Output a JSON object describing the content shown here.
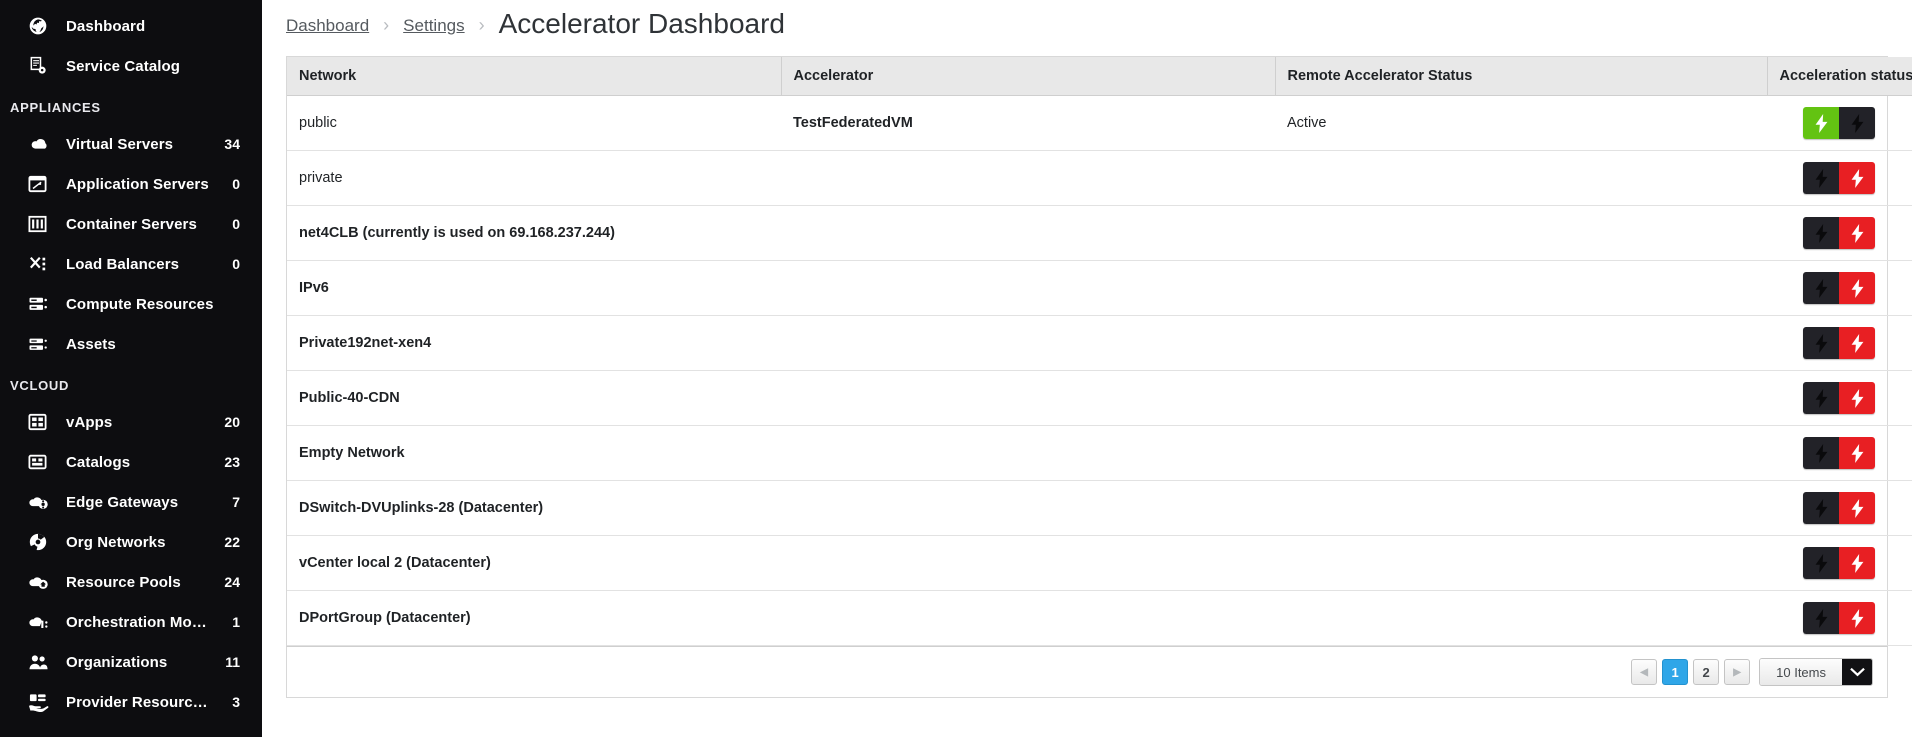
{
  "sidebar": {
    "top_items": [
      {
        "label": "Dashboard",
        "icon": "globe-icon",
        "count": ""
      },
      {
        "label": "Service Catalog",
        "icon": "catalog-gear-icon",
        "count": ""
      }
    ],
    "sections": [
      {
        "title": "APPLIANCES",
        "items": [
          {
            "label": "Virtual Servers",
            "icon": "cloud-icon",
            "count": "34"
          },
          {
            "label": "Application Servers",
            "icon": "window-icon",
            "count": "0"
          },
          {
            "label": "Container Servers",
            "icon": "container-icon",
            "count": "0"
          },
          {
            "label": "Load Balancers",
            "icon": "balance-icon",
            "count": "0"
          },
          {
            "label": "Compute Resources",
            "icon": "server-rack-icon",
            "count": ""
          },
          {
            "label": "Assets",
            "icon": "server-stack-icon",
            "count": ""
          }
        ]
      },
      {
        "title": "VCLOUD",
        "items": [
          {
            "label": "vApps",
            "icon": "grid-icon",
            "count": "20"
          },
          {
            "label": "Catalogs",
            "icon": "catalog-grid-icon",
            "count": "23"
          },
          {
            "label": "Edge Gateways",
            "icon": "cloud-gear-icon",
            "count": "7"
          },
          {
            "label": "Org Networks",
            "icon": "network-orb-icon",
            "count": "22"
          },
          {
            "label": "Resource Pools",
            "icon": "cloud-home-icon",
            "count": "24"
          },
          {
            "label": "Orchestration Models",
            "icon": "cloud-info-icon",
            "count": "1"
          },
          {
            "label": "Organizations",
            "icon": "people-icon",
            "count": "11"
          },
          {
            "label": "Provider Resource ...",
            "icon": "hand-card-icon",
            "count": "3"
          }
        ]
      }
    ]
  },
  "breadcrumb": {
    "items": [
      {
        "label": "Dashboard",
        "link": true
      },
      {
        "label": "Settings",
        "link": true
      }
    ],
    "separator": "›",
    "current": "Accelerator Dashboard"
  },
  "table": {
    "columns": [
      "Network",
      "Accelerator",
      "Remote Accelerator Status",
      "Acceleration status"
    ],
    "rows": [
      {
        "network": "public",
        "network_bold": false,
        "accelerator": "TestFederatedVM",
        "remote_status": "Active",
        "enabled": true
      },
      {
        "network": "private",
        "network_bold": false,
        "accelerator": "",
        "remote_status": "",
        "enabled": false
      },
      {
        "network": "net4CLB (currently is used on 69.168.237.244)",
        "network_bold": true,
        "accelerator": "",
        "remote_status": "",
        "enabled": false
      },
      {
        "network": "IPv6",
        "network_bold": true,
        "accelerator": "",
        "remote_status": "",
        "enabled": false
      },
      {
        "network": "Private192net-xen4",
        "network_bold": true,
        "accelerator": "",
        "remote_status": "",
        "enabled": false
      },
      {
        "network": "Public-40-CDN",
        "network_bold": true,
        "accelerator": "",
        "remote_status": "",
        "enabled": false
      },
      {
        "network": "Empty Network",
        "network_bold": true,
        "accelerator": "",
        "remote_status": "",
        "enabled": false
      },
      {
        "network": "DSwitch-DVUplinks-28 (Datacenter)",
        "network_bold": true,
        "accelerator": "",
        "remote_status": "",
        "enabled": false
      },
      {
        "network": "vCenter local 2 (Datacenter)",
        "network_bold": true,
        "accelerator": "",
        "remote_status": "",
        "enabled": false
      },
      {
        "network": "DPortGroup (Datacenter)",
        "network_bold": true,
        "accelerator": "",
        "remote_status": "",
        "enabled": false
      }
    ]
  },
  "pagination": {
    "prev_icon": "◀",
    "next_icon": "▶",
    "pages": [
      "1",
      "2"
    ],
    "active_page": "1",
    "per_page_label": "10 Items"
  },
  "colors": {
    "sidebar_bg": "#0d0d10",
    "accent_blue": "#2fa6e8",
    "enabled_green": "#63c312",
    "disabled_red": "#e81f23",
    "toggle_dark": "#222228",
    "header_bg": "#e8e8e8"
  }
}
